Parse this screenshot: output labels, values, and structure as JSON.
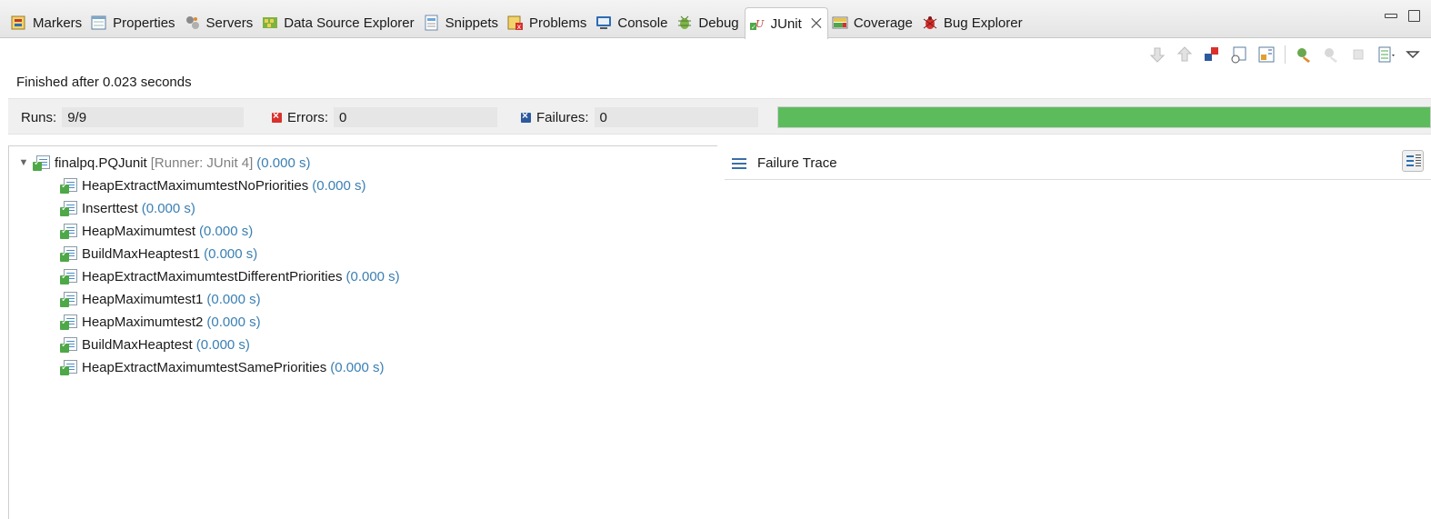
{
  "tabs": [
    {
      "label": "Markers",
      "icon": "markers-icon"
    },
    {
      "label": "Properties",
      "icon": "properties-icon"
    },
    {
      "label": "Servers",
      "icon": "servers-icon"
    },
    {
      "label": "Data Source Explorer",
      "icon": "data-source-icon"
    },
    {
      "label": "Snippets",
      "icon": "snippets-icon"
    },
    {
      "label": "Problems",
      "icon": "problems-icon"
    },
    {
      "label": "Console",
      "icon": "console-icon"
    },
    {
      "label": "Debug",
      "icon": "debug-icon"
    },
    {
      "label": "JUnit",
      "icon": "junit-icon",
      "active": true,
      "close": "⨉"
    },
    {
      "label": "Coverage",
      "icon": "coverage-icon"
    },
    {
      "label": "Bug Explorer",
      "icon": "bug-explorer-icon"
    }
  ],
  "status": {
    "finished": "Finished after 0.023 seconds"
  },
  "counters": {
    "runs_label": "Runs:",
    "runs_value": "9/9",
    "errors_label": "Errors:",
    "errors_value": "0",
    "failures_label": "Failures:",
    "failures_value": "0",
    "progress_fraction": 1.0,
    "progress_color": "#5cbc5c"
  },
  "tree": {
    "root": {
      "name": "finalpq.PQJunit",
      "runner": "[Runner: JUnit 4]",
      "time": "(0.000 s)"
    },
    "tests": [
      {
        "name": "HeapExtractMaximumtestNoPriorities",
        "time": "(0.000 s)"
      },
      {
        "name": "Inserttest",
        "time": "(0.000 s)"
      },
      {
        "name": "HeapMaximumtest",
        "time": "(0.000 s)"
      },
      {
        "name": "BuildMaxHeaptest1",
        "time": "(0.000 s)"
      },
      {
        "name": "HeapExtractMaximumtestDifferentPriorities",
        "time": "(0.000 s)"
      },
      {
        "name": "HeapMaximumtest1",
        "time": "(0.000 s)"
      },
      {
        "name": "HeapMaximumtest2",
        "time": "(0.000 s)"
      },
      {
        "name": "BuildMaxHeaptest",
        "time": "(0.000 s)"
      },
      {
        "name": "HeapExtractMaximumtestSamePriorities",
        "time": "(0.000 s)"
      }
    ]
  },
  "trace": {
    "title": "Failure Trace"
  },
  "colors": {
    "time_text": "#3a7fb3",
    "runner_text": "#808080",
    "error_mark": "#d9302c",
    "failure_mark": "#2c5a9e"
  }
}
